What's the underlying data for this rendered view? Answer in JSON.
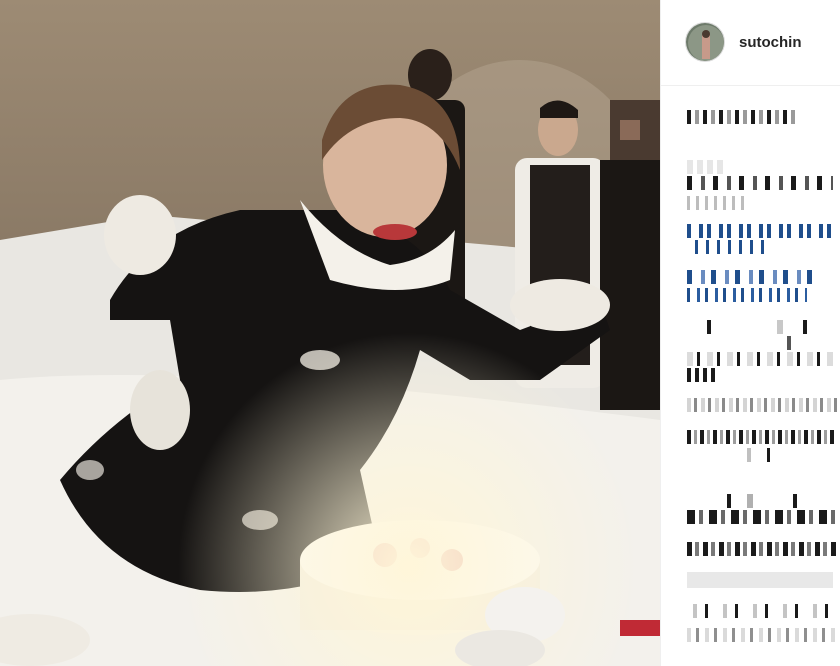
{
  "post": {
    "username": "sutochin",
    "colors": {
      "panel_bg": "#ffffff",
      "divider": "#efefef",
      "username": "#262626",
      "link_blue": "#1f4e8c",
      "dark_pixel": "#1a1a1a"
    }
  }
}
